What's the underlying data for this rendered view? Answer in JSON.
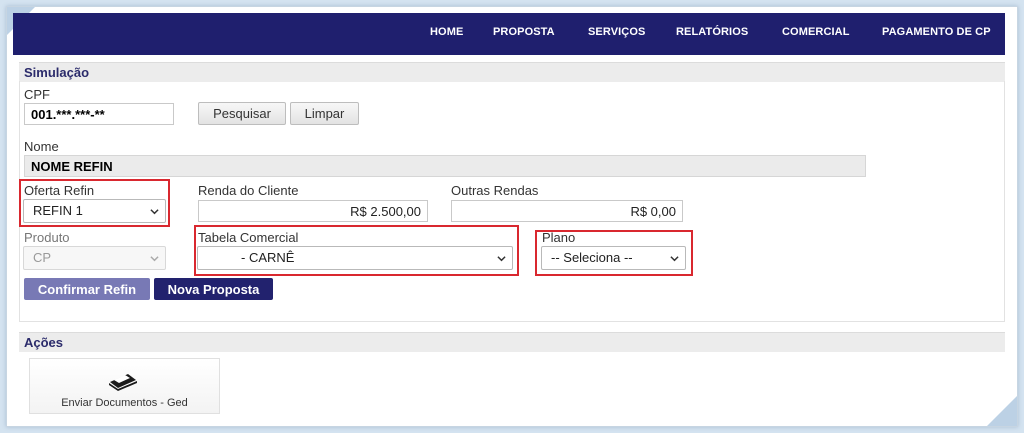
{
  "nav": {
    "items": [
      "HOME",
      "PROPOSTA",
      "SERVIÇOS",
      "RELATÓRIOS",
      "COMERCIAL",
      "PAGAMENTO DE CP"
    ]
  },
  "simulacao": {
    "title": "Simulação",
    "cpf": {
      "label": "CPF",
      "value": "001.***.***-**"
    },
    "pesquisar_label": "Pesquisar",
    "limpar_label": "Limpar",
    "nome": {
      "label": "Nome",
      "value": "NOME REFIN"
    },
    "oferta_refin": {
      "label": "Oferta Refin",
      "value": "REFIN 1"
    },
    "renda_cliente": {
      "label": "Renda do Cliente",
      "value": "R$ 2.500,00"
    },
    "outras_rendas": {
      "label": "Outras Rendas",
      "value": "R$ 0,00"
    },
    "produto": {
      "label": "Produto",
      "value": "CP"
    },
    "tabela_comercial": {
      "label": "Tabela Comercial",
      "value": "- CARNÊ"
    },
    "plano": {
      "label": "Plano",
      "value": "-- Seleciona --"
    },
    "confirmar_label": "Confirmar Refin",
    "nova_proposta_label": "Nova Proposta"
  },
  "acoes": {
    "title": "Ações",
    "enviar_documentos_label": "Enviar Documentos - Ged"
  },
  "colors": {
    "nav_bg": "#1f1f6e",
    "highlight": "#d9282f",
    "confirm_btn": "#7879b5",
    "nova_btn": "#22226e"
  }
}
